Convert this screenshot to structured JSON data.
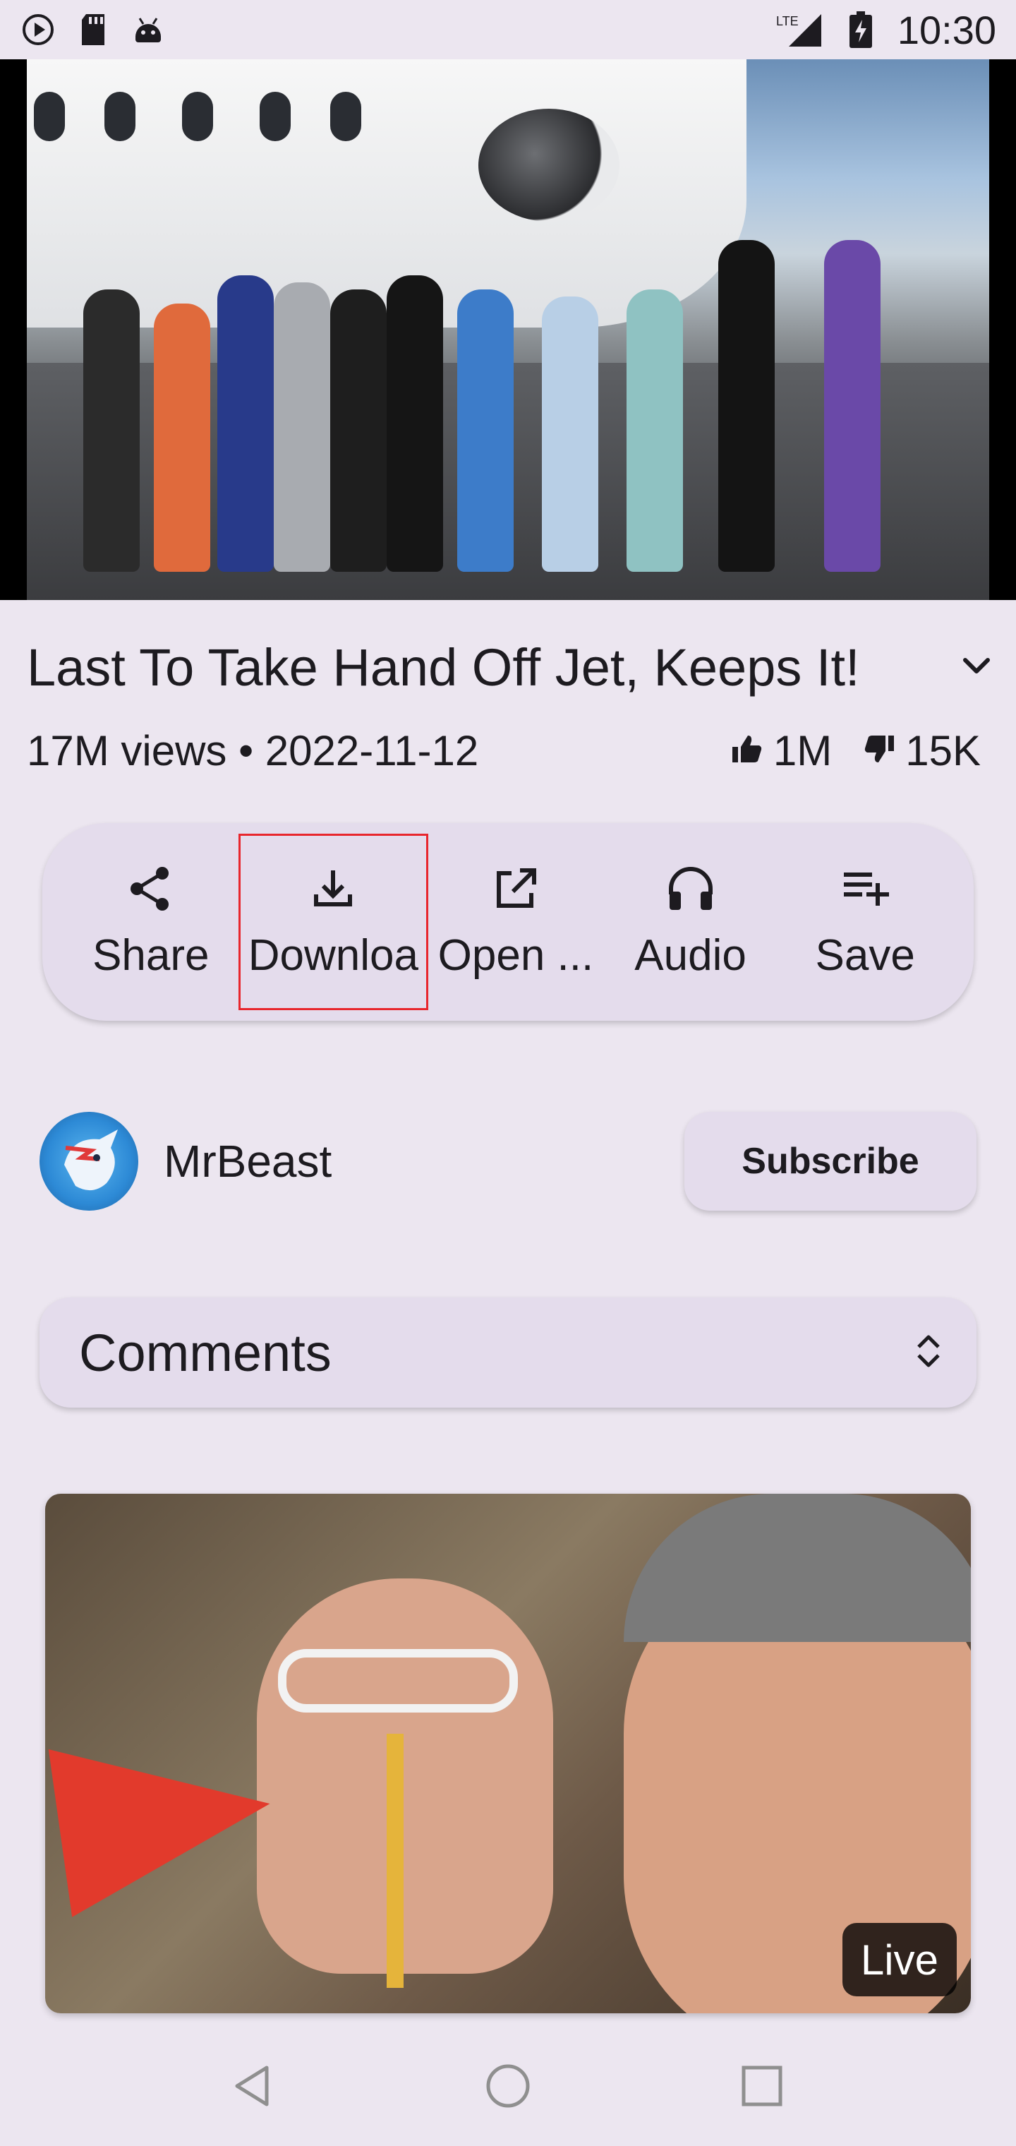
{
  "status_bar": {
    "time": "10:30",
    "network": "LTE",
    "icons": [
      "play-circle-icon",
      "sd-card-icon",
      "android-icon",
      "signal-icon",
      "battery-icon"
    ]
  },
  "video": {
    "title": "Last To Take Hand Off Jet, Keeps It!",
    "views_date": "17M views • 2022-11-12",
    "likes": "1M",
    "dislikes": "15K"
  },
  "actions": [
    {
      "label": "Share",
      "icon": "share-icon"
    },
    {
      "label": "Downloa",
      "icon": "download-icon"
    },
    {
      "label": "Open ...",
      "icon": "open-external-icon"
    },
    {
      "label": "Audio",
      "icon": "headphones-icon"
    },
    {
      "label": "Save",
      "icon": "playlist-add-icon"
    }
  ],
  "channel": {
    "name": "MrBeast",
    "subscribe_label": "Subscribe"
  },
  "comments": {
    "label": "Comments"
  },
  "next_video": {
    "badge": "Live"
  },
  "colors": {
    "background": "#ECE6F0",
    "surface": "#E4DCEC",
    "selection_border": "#E8262D"
  }
}
